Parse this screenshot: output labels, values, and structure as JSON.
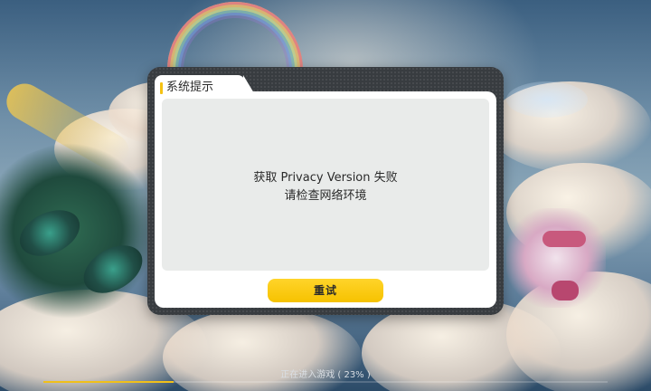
{
  "dialog": {
    "title": "系统提示",
    "message_line1": "获取 Privacy Version 失败",
    "message_line2": "请检查网络环境",
    "retry_label": "重试"
  },
  "loading": {
    "text": "正在进入游戏 ( 23% )",
    "progress": 0.23
  },
  "colors": {
    "accent": "#f6c200",
    "dialog_frame": "#383c40",
    "message_panel": "#e9ebea",
    "loading_fill": "#f0c01a"
  },
  "icons": {
    "title_marker": "yellow-bar-marker"
  }
}
